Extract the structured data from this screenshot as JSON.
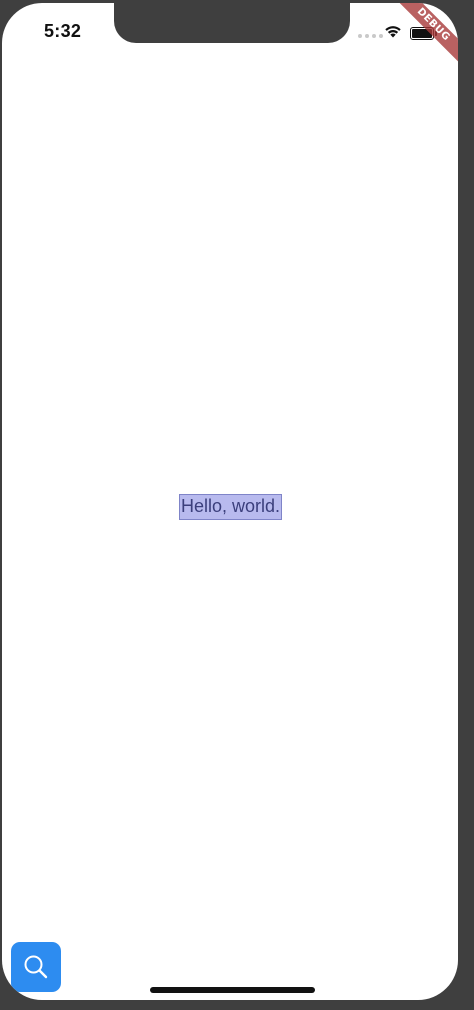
{
  "status_bar": {
    "time": "5:32",
    "signal_icon": "signal-dots-icon",
    "wifi_icon": "wifi-icon",
    "battery_icon": "battery-icon",
    "battery_level": 1.0
  },
  "debug_banner": {
    "label": "DEBUG"
  },
  "main": {
    "text": "Hello, world."
  },
  "fab": {
    "icon": "search-icon",
    "color": "#2d8cf0"
  },
  "colors": {
    "debug_banner": "#a83a3a",
    "highlight": "#b8baee",
    "text": "#3b3f7c"
  }
}
